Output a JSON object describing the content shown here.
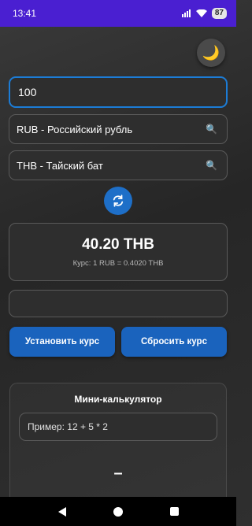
{
  "status_bar": {
    "time": "13:41",
    "battery": "87"
  },
  "icons": {
    "theme": "moon-icon",
    "search": "search-icon",
    "swap": "swap-arrows-icon"
  },
  "converter": {
    "amount": "100",
    "from_currency": "RUB - Российский рубль",
    "to_currency": "THB - Тайский бат",
    "result": "40.20 THB",
    "rate": "Курс: 1 RUB = 0.4020 THB"
  },
  "buttons": {
    "set_rate": "Установить курс",
    "reset_rate": "Сбросить курс"
  },
  "mini_calc": {
    "title": "Мини-калькулятор",
    "placeholder": "Пример: 12 + 5 * 2",
    "result": "–"
  },
  "colors": {
    "accent": "#1c7cd6",
    "button": "#1a63bd",
    "status_bar": "#4a1fd1"
  }
}
